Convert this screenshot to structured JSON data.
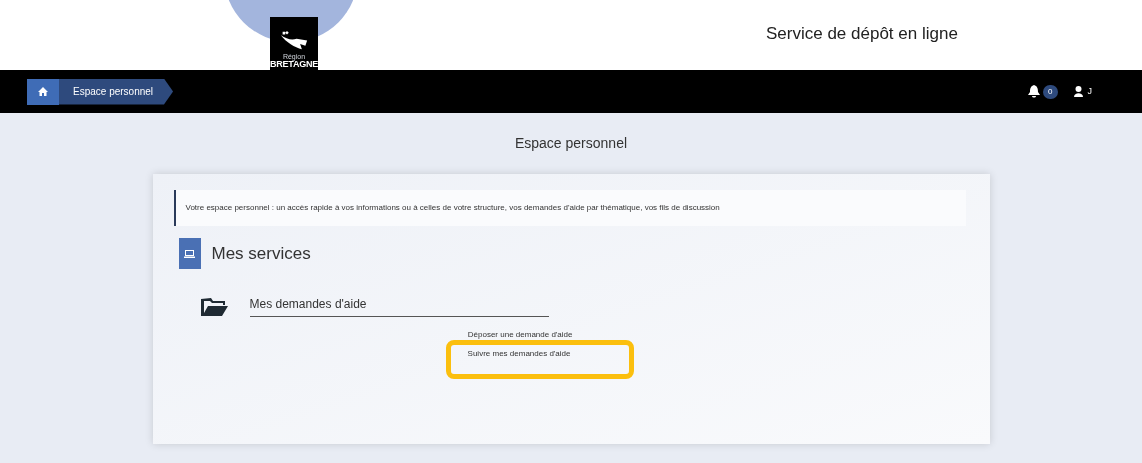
{
  "header": {
    "logo": {
      "line_1": "Région",
      "line_2": "BRETAGNE"
    },
    "title": "Service de dépôt en ligne"
  },
  "navbar": {
    "breadcrumb": [
      {
        "label": "Espace personnel"
      }
    ],
    "notifications": "0",
    "user": "J"
  },
  "page": {
    "title": "Espace personnel",
    "intro": "Votre espace personnel : un accès rapide à vos informations ou à celles de votre structure, vos demandes d'aide par thématique, vos fils de discussion",
    "section": "Mes services",
    "services": [
      {
        "title": "Mes demandes d'aide",
        "links": [
          {
            "label": "Déposer une demande d'aide",
            "highlighted": false
          },
          {
            "label": "Suivre mes demandes d'aide",
            "highlighted": true
          }
        ]
      }
    ]
  }
}
